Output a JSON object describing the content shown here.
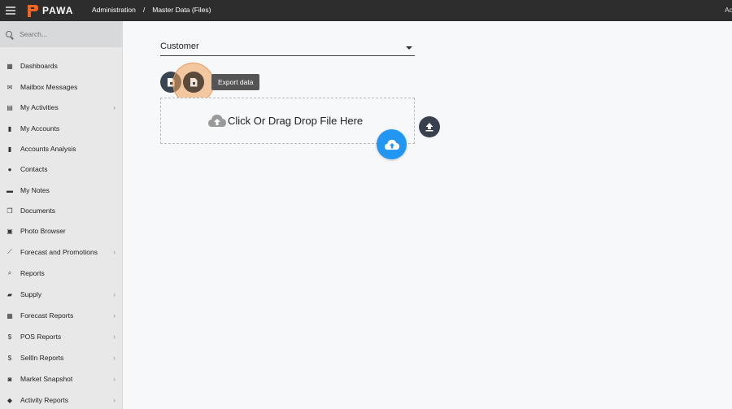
{
  "header": {
    "brand": "PAWA",
    "breadcrumb": [
      "Administration",
      "Master Data (Files)"
    ],
    "breadcrumb_separator": "/",
    "right_text": "Ac",
    "background": "#2d2d2d",
    "brand_color": "#f26522"
  },
  "sidebar": {
    "search_placeholder": "Search...",
    "items": [
      {
        "label": "Dashboards",
        "icon": "dashboard-icon",
        "chevron": false
      },
      {
        "label": "Mailbox Messages",
        "icon": "mail-icon",
        "chevron": false
      },
      {
        "label": "My Activities",
        "icon": "calendar-icon",
        "chevron": true
      },
      {
        "label": "My Accounts",
        "icon": "building-icon",
        "chevron": false
      },
      {
        "label": "Accounts Analysis",
        "icon": "building-icon",
        "chevron": false
      },
      {
        "label": "Contacts",
        "icon": "user-icon",
        "chevron": false
      },
      {
        "label": "My Notes",
        "icon": "note-icon",
        "chevron": false
      },
      {
        "label": "Documents",
        "icon": "documents-icon",
        "chevron": false
      },
      {
        "label": "Photo Browser",
        "icon": "image-icon",
        "chevron": false
      },
      {
        "label": "Forecast and Promotions",
        "icon": "trend-icon",
        "chevron": true
      },
      {
        "label": "Reports",
        "icon": "search-icon",
        "chevron": false
      },
      {
        "label": "Supply",
        "icon": "truck-icon",
        "chevron": true
      },
      {
        "label": "Forecast Reports",
        "icon": "table-icon",
        "chevron": true
      },
      {
        "label": "POS Reports",
        "icon": "dollar-icon",
        "chevron": true
      },
      {
        "label": "SellIn Reports",
        "icon": "dollar-icon",
        "chevron": true
      },
      {
        "label": "Market Snapshot",
        "icon": "camera-icon",
        "chevron": true
      },
      {
        "label": "Activity Reports",
        "icon": "cube-icon",
        "chevron": true
      }
    ]
  },
  "main": {
    "select_value": "Customer",
    "tooltip": "Export data",
    "dropzone_text": "Click Or Drag Drop File Here",
    "accent": "#2196f3",
    "button_color": "#3a4552"
  }
}
